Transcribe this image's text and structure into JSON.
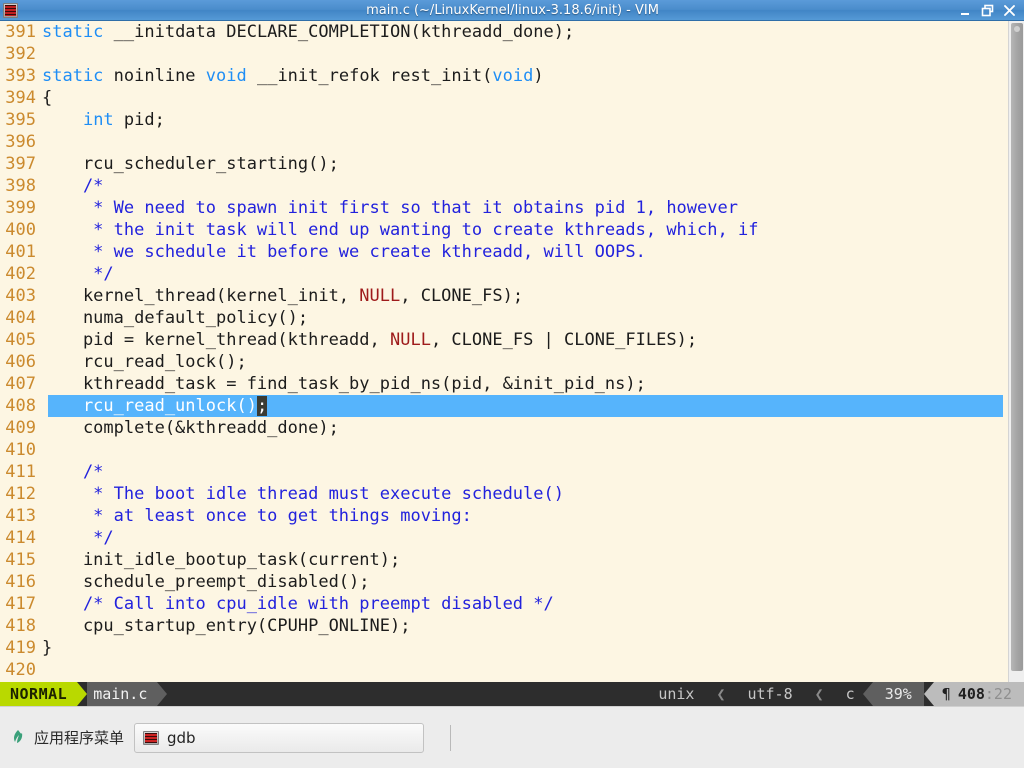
{
  "window": {
    "title": "main.c (~/LinuxKernel/linux-3.18.6/init) - VIM",
    "app_icon": "terminal-icon",
    "minimize_icon": "minimize-icon",
    "maximize_icon": "maximize-icon",
    "close_icon": "close-icon"
  },
  "editor": {
    "first_line": 391,
    "cursor_line": 408,
    "lines": [
      {
        "n": "391",
        "segs": [
          {
            "t": "static",
            "c": "kw"
          },
          {
            "t": " __initdata DECLARE_COMPLETION(kthreadd_done);",
            "c": "ltext"
          }
        ]
      },
      {
        "n": "392",
        "segs": [
          {
            "t": "",
            "c": "ltext"
          }
        ]
      },
      {
        "n": "393",
        "segs": [
          {
            "t": "static",
            "c": "kw"
          },
          {
            "t": " noinline ",
            "c": "ltext"
          },
          {
            "t": "void",
            "c": "kw"
          },
          {
            "t": " __init_refok rest_init(",
            "c": "ltext"
          },
          {
            "t": "void",
            "c": "kw"
          },
          {
            "t": ")",
            "c": "ltext"
          }
        ]
      },
      {
        "n": "394",
        "segs": [
          {
            "t": "{",
            "c": "ltext"
          }
        ]
      },
      {
        "n": "395",
        "segs": [
          {
            "t": "    ",
            "c": "ltext"
          },
          {
            "t": "int",
            "c": "kw"
          },
          {
            "t": " pid;",
            "c": "ltext"
          }
        ]
      },
      {
        "n": "396",
        "segs": [
          {
            "t": "",
            "c": "ltext"
          }
        ]
      },
      {
        "n": "397",
        "segs": [
          {
            "t": "    rcu_scheduler_starting();",
            "c": "ltext"
          }
        ]
      },
      {
        "n": "398",
        "segs": [
          {
            "t": "    /*",
            "c": "cmt"
          }
        ]
      },
      {
        "n": "399",
        "segs": [
          {
            "t": "     * We need to spawn init first so that it obtains pid 1, however",
            "c": "cmt"
          }
        ]
      },
      {
        "n": "400",
        "segs": [
          {
            "t": "     * the init task will end up wanting to create kthreads, which, if",
            "c": "cmt"
          }
        ]
      },
      {
        "n": "401",
        "segs": [
          {
            "t": "     * we schedule it before we create kthreadd, will OOPS.",
            "c": "cmt"
          }
        ]
      },
      {
        "n": "402",
        "segs": [
          {
            "t": "     */",
            "c": "cmt"
          }
        ]
      },
      {
        "n": "403",
        "segs": [
          {
            "t": "    kernel_thread(kernel_init, ",
            "c": "ltext"
          },
          {
            "t": "NULL",
            "c": "nul"
          },
          {
            "t": ", CLONE_FS);",
            "c": "ltext"
          }
        ]
      },
      {
        "n": "404",
        "segs": [
          {
            "t": "    numa_default_policy();",
            "c": "ltext"
          }
        ]
      },
      {
        "n": "405",
        "segs": [
          {
            "t": "    pid = kernel_thread(kthreadd, ",
            "c": "ltext"
          },
          {
            "t": "NULL",
            "c": "nul"
          },
          {
            "t": ", CLONE_FS | CLONE_FILES);",
            "c": "ltext"
          }
        ]
      },
      {
        "n": "406",
        "segs": [
          {
            "t": "    rcu_read_lock();",
            "c": "ltext"
          }
        ]
      },
      {
        "n": "407",
        "segs": [
          {
            "t": "    kthreadd_task = find_task_by_pid_ns(pid, &init_pid_ns);",
            "c": "ltext"
          }
        ]
      },
      {
        "n": "408",
        "cursor": true,
        "segs": [
          {
            "t": "    rcu_read_unlock()",
            "c": "ltext"
          },
          {
            "t": ";",
            "c": "cursorblk"
          }
        ]
      },
      {
        "n": "409",
        "segs": [
          {
            "t": "    complete(&kthreadd_done);",
            "c": "ltext"
          }
        ]
      },
      {
        "n": "410",
        "segs": [
          {
            "t": "",
            "c": "ltext"
          }
        ]
      },
      {
        "n": "411",
        "segs": [
          {
            "t": "    /*",
            "c": "cmt"
          }
        ]
      },
      {
        "n": "412",
        "segs": [
          {
            "t": "     * The boot idle thread must execute schedule()",
            "c": "cmt"
          }
        ]
      },
      {
        "n": "413",
        "segs": [
          {
            "t": "     * at least once to get things moving:",
            "c": "cmt"
          }
        ]
      },
      {
        "n": "414",
        "segs": [
          {
            "t": "     */",
            "c": "cmt"
          }
        ]
      },
      {
        "n": "415",
        "segs": [
          {
            "t": "    init_idle_bootup_task(current);",
            "c": "ltext"
          }
        ]
      },
      {
        "n": "416",
        "segs": [
          {
            "t": "    schedule_preempt_disabled();",
            "c": "ltext"
          }
        ]
      },
      {
        "n": "417",
        "segs": [
          {
            "t": "    /* Call into cpu_idle with preempt disabled */",
            "c": "cmt"
          }
        ]
      },
      {
        "n": "418",
        "segs": [
          {
            "t": "    cpu_startup_entry(CPUHP_ONLINE);",
            "c": "ltext"
          }
        ]
      },
      {
        "n": "419",
        "segs": [
          {
            "t": "}",
            "c": "ltext"
          }
        ]
      },
      {
        "n": "420",
        "segs": [
          {
            "t": "",
            "c": "ltext"
          }
        ]
      }
    ]
  },
  "statusline": {
    "mode": "NORMAL",
    "filename": "main.c",
    "fileformat": "unix",
    "encoding": "utf-8",
    "filetype": "c",
    "separator": "❮",
    "percent": "39%",
    "para_icon": "¶",
    "line": "408",
    "col": ":22"
  },
  "taskbar": {
    "menu_icon": "leaf-icon",
    "menu_label": "应用程序菜单",
    "tasks": [
      {
        "icon": "terminal-icon",
        "label": "gdb"
      }
    ]
  },
  "colors": {
    "title_bar": "#4a8ccb",
    "editor_bg": "#fdf6e3",
    "line_number": "#cb8a2e",
    "keyword": "#1f8ef5",
    "comment": "#2222dd",
    "constant": "#9e1b1b",
    "cursorline": "#56b4fc",
    "mode_badge": "#b9d900",
    "statusline_bg": "#2d2d2d"
  }
}
